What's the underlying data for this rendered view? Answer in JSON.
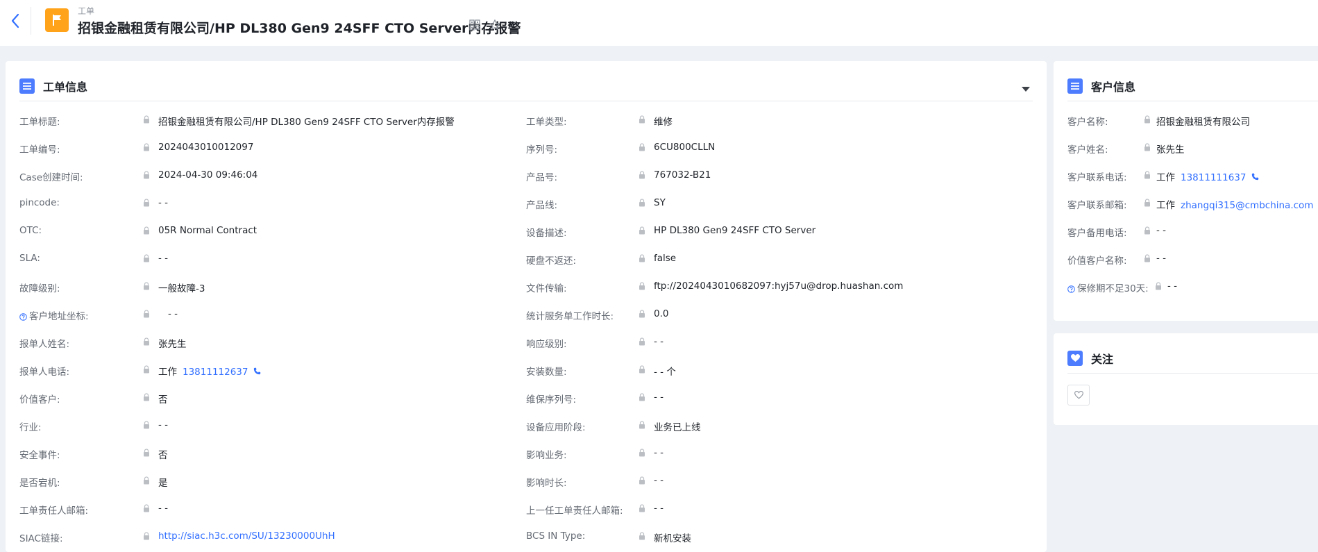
{
  "header": {
    "breadcrumb": "工单",
    "title": "招银金融租赁有限公司/HP DL380 Gen9 24SFF CTO Server内存报警"
  },
  "colors": {
    "accent": "#4d7cfe",
    "flag": "#ffa31a",
    "link": "#3370ff"
  },
  "icons": {
    "back": "chevron-left-icon",
    "flag": "flag-icon",
    "lock": "lock-icon",
    "phone": "phone-icon",
    "heart": "heart-icon",
    "help": "help-circle-icon"
  },
  "work_order": {
    "title": "工单信息",
    "left": [
      {
        "label": "工单标题:",
        "value": "招银金融租赁有限公司/HP DL380 Gen9 24SFF CTO Server内存报警"
      },
      {
        "label": "工单编号:",
        "value": "2024043010012097"
      },
      {
        "label": "Case创建时间:",
        "value": "2024-04-30 09:46:04"
      },
      {
        "label": "pincode:",
        "value": "- -"
      },
      {
        "label": "OTC:",
        "value": "05R Normal Contract"
      },
      {
        "label": "SLA:",
        "value": "- -"
      },
      {
        "label": "故障级别:",
        "value": "一般故障-3"
      },
      {
        "label": "客户地址坐标:",
        "value": "- -"
      },
      {
        "label": "报单人姓名:",
        "value": "张先生"
      },
      {
        "label": "报单人电话:",
        "prefix": "工作",
        "value": "13811112637"
      },
      {
        "label": "价值客户:",
        "value": "否"
      },
      {
        "label": "行业:",
        "value": "- -"
      },
      {
        "label": "安全事件:",
        "value": "否"
      },
      {
        "label": "是否宕机:",
        "value": "是"
      },
      {
        "label": "工单责任人邮箱:",
        "value": "- -"
      },
      {
        "label": "SIAC链接:",
        "value": "http://siac.h3c.com/SU/13230000UhH"
      }
    ],
    "right": [
      {
        "label": "工单类型:",
        "value": "维修"
      },
      {
        "label": "序列号:",
        "value": "6CU800CLLN"
      },
      {
        "label": "产品号:",
        "value": "767032-B21"
      },
      {
        "label": "产品线:",
        "value": "SY"
      },
      {
        "label": "设备描述:",
        "value": "HP DL380 Gen9 24SFF CTO Server"
      },
      {
        "label": "硬盘不返还:",
        "value": "false"
      },
      {
        "label": "文件传输:",
        "value": "ftp://2024043010682097:hyj57u@drop.huashan.com"
      },
      {
        "label": "统计服务单工作时长:",
        "value": "0.0"
      },
      {
        "label": "响应级别:",
        "value": "- -"
      },
      {
        "label": "安装数量:",
        "value": "- - 个"
      },
      {
        "label": "维保序列号:",
        "value": "- -"
      },
      {
        "label": "设备应用阶段:",
        "value": "业务已上线"
      },
      {
        "label": "影响业务:",
        "value": "- -"
      },
      {
        "label": "影响时长:",
        "value": "- -"
      },
      {
        "label": "上一任工单责任人邮箱:",
        "value": "- -"
      },
      {
        "label": "BCS IN Type:",
        "value": "新机安装"
      }
    ]
  },
  "customer": {
    "title": "客户信息",
    "fields": [
      {
        "label": "客户名称:",
        "value": "招银金融租赁有限公司"
      },
      {
        "label": "客户姓名:",
        "value": "张先生"
      },
      {
        "label": "客户联系电话:",
        "prefix": "工作",
        "value": "13811111637"
      },
      {
        "label": "客户联系邮箱:",
        "prefix": "工作",
        "value": "zhangqi315@cmbchina.com"
      },
      {
        "label": "客户备用电话:",
        "value": "- -"
      },
      {
        "label": "价值客户名称:",
        "value": "- -"
      },
      {
        "label": "保修期不足30天:",
        "value": "- -"
      }
    ]
  },
  "follow": {
    "title": "关注"
  }
}
